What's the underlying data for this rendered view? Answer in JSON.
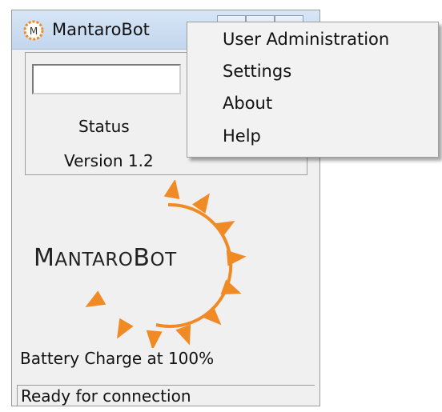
{
  "window": {
    "title": "MantaroBot",
    "app_icon": "mantarobot-m-icon",
    "controls": {
      "minimize_icon": "minimize-icon",
      "maximize_icon": "maximize-icon",
      "close_icon": "close-icon"
    }
  },
  "main": {
    "input_value": "",
    "status_label": "Status",
    "version_label": "Version 1.2"
  },
  "logo": {
    "text": "MantaroBot",
    "sun_color": "#f08a24"
  },
  "battery_text": "Battery Charge at 100%",
  "status_bar": {
    "text": "Ready for connection"
  },
  "context_menu": {
    "items": [
      {
        "label": "User Administration"
      },
      {
        "label": "Settings"
      },
      {
        "label": "About"
      },
      {
        "label": "Help"
      }
    ]
  }
}
